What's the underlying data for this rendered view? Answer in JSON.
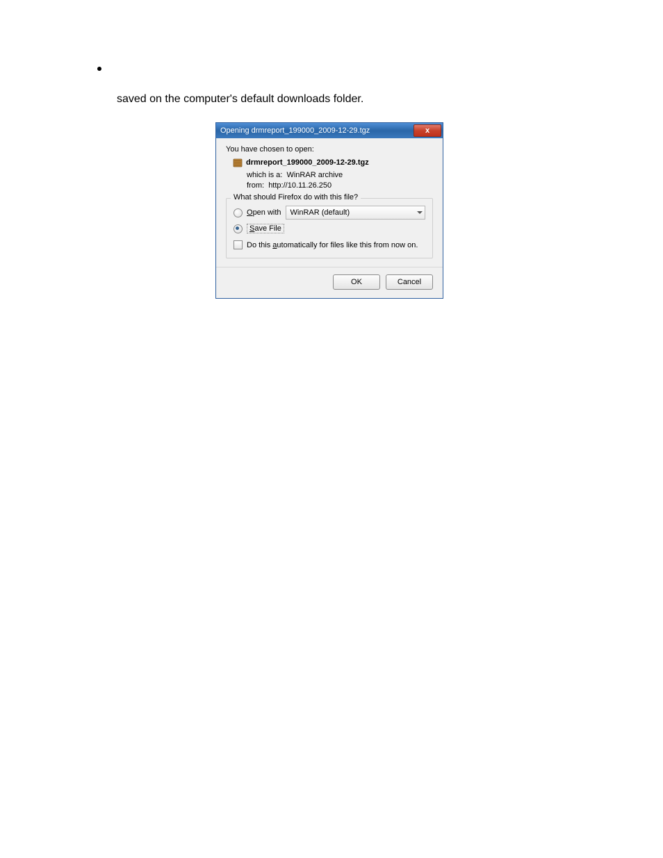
{
  "bullet_glyph": "•",
  "caption": "saved on the computer's default downloads folder.",
  "dialog": {
    "title": "Opening drmreport_199000_2009-12-29.tgz",
    "close_glyph": "x",
    "chosen_label": "You have chosen to open:",
    "file_name": "drmreport_199000_2009-12-29.tgz",
    "which_is_prefix": "which is a:",
    "which_is_value": "WinRAR archive",
    "from_prefix": "from:",
    "from_value": "http://10.11.26.250",
    "legend": "What should Firefox do with this file?",
    "open_with_prefix": "O",
    "open_with_rest": "pen with",
    "open_with_app": "WinRAR (default)",
    "save_prefix": "S",
    "save_rest": "ave File",
    "auto_pre": "Do this ",
    "auto_u": "a",
    "auto_post": "utomatically for files like this from now on.",
    "ok": "OK",
    "cancel": "Cancel"
  }
}
